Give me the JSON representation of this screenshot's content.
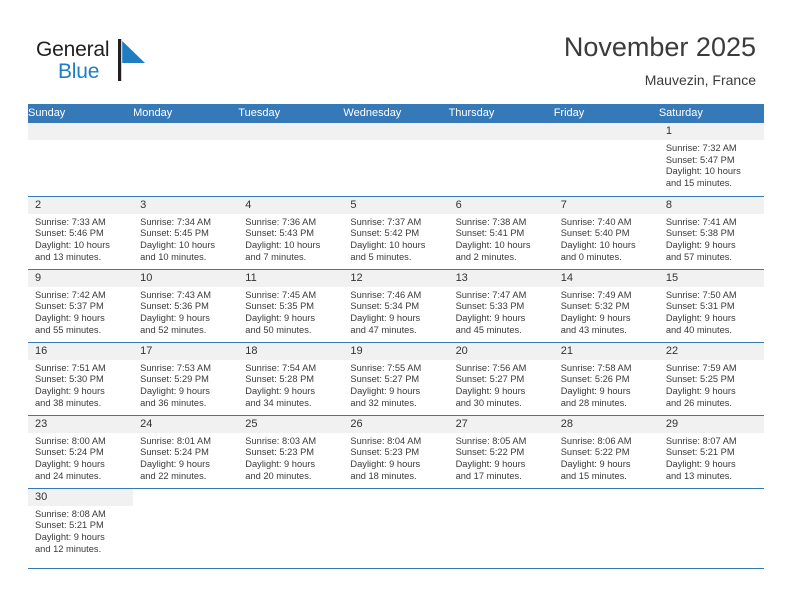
{
  "brand": {
    "name_part1": "General",
    "name_part2": "Blue",
    "flag_icon": "blue-triangle-flag-icon"
  },
  "header": {
    "title": "November 2025",
    "subtitle": "Mauvezin, France"
  },
  "calendar": {
    "weekday_headers": [
      "Sunday",
      "Monday",
      "Tuesday",
      "Wednesday",
      "Thursday",
      "Friday",
      "Saturday"
    ],
    "accent_color": "#3579b8",
    "daynum_band_color": "#f1f1f1",
    "labels": {
      "sunrise": "Sunrise:",
      "sunset": "Sunset:",
      "daylight": "Daylight:"
    },
    "weeks": [
      [
        {
          "blank": true
        },
        {
          "blank": true
        },
        {
          "blank": true
        },
        {
          "blank": true
        },
        {
          "blank": true
        },
        {
          "blank": true
        },
        {
          "day": "1",
          "sunrise": "Sunrise: 7:32 AM",
          "sunset": "Sunset: 5:47 PM",
          "daylight_line1": "Daylight: 10 hours",
          "daylight_line2": "and 15 minutes."
        }
      ],
      [
        {
          "day": "2",
          "sunrise": "Sunrise: 7:33 AM",
          "sunset": "Sunset: 5:46 PM",
          "daylight_line1": "Daylight: 10 hours",
          "daylight_line2": "and 13 minutes."
        },
        {
          "day": "3",
          "sunrise": "Sunrise: 7:34 AM",
          "sunset": "Sunset: 5:45 PM",
          "daylight_line1": "Daylight: 10 hours",
          "daylight_line2": "and 10 minutes."
        },
        {
          "day": "4",
          "sunrise": "Sunrise: 7:36 AM",
          "sunset": "Sunset: 5:43 PM",
          "daylight_line1": "Daylight: 10 hours",
          "daylight_line2": "and 7 minutes."
        },
        {
          "day": "5",
          "sunrise": "Sunrise: 7:37 AM",
          "sunset": "Sunset: 5:42 PM",
          "daylight_line1": "Daylight: 10 hours",
          "daylight_line2": "and 5 minutes."
        },
        {
          "day": "6",
          "sunrise": "Sunrise: 7:38 AM",
          "sunset": "Sunset: 5:41 PM",
          "daylight_line1": "Daylight: 10 hours",
          "daylight_line2": "and 2 minutes."
        },
        {
          "day": "7",
          "sunrise": "Sunrise: 7:40 AM",
          "sunset": "Sunset: 5:40 PM",
          "daylight_line1": "Daylight: 10 hours",
          "daylight_line2": "and 0 minutes."
        },
        {
          "day": "8",
          "sunrise": "Sunrise: 7:41 AM",
          "sunset": "Sunset: 5:38 PM",
          "daylight_line1": "Daylight: 9 hours",
          "daylight_line2": "and 57 minutes."
        }
      ],
      [
        {
          "day": "9",
          "sunrise": "Sunrise: 7:42 AM",
          "sunset": "Sunset: 5:37 PM",
          "daylight_line1": "Daylight: 9 hours",
          "daylight_line2": "and 55 minutes."
        },
        {
          "day": "10",
          "sunrise": "Sunrise: 7:43 AM",
          "sunset": "Sunset: 5:36 PM",
          "daylight_line1": "Daylight: 9 hours",
          "daylight_line2": "and 52 minutes."
        },
        {
          "day": "11",
          "sunrise": "Sunrise: 7:45 AM",
          "sunset": "Sunset: 5:35 PM",
          "daylight_line1": "Daylight: 9 hours",
          "daylight_line2": "and 50 minutes."
        },
        {
          "day": "12",
          "sunrise": "Sunrise: 7:46 AM",
          "sunset": "Sunset: 5:34 PM",
          "daylight_line1": "Daylight: 9 hours",
          "daylight_line2": "and 47 minutes."
        },
        {
          "day": "13",
          "sunrise": "Sunrise: 7:47 AM",
          "sunset": "Sunset: 5:33 PM",
          "daylight_line1": "Daylight: 9 hours",
          "daylight_line2": "and 45 minutes."
        },
        {
          "day": "14",
          "sunrise": "Sunrise: 7:49 AM",
          "sunset": "Sunset: 5:32 PM",
          "daylight_line1": "Daylight: 9 hours",
          "daylight_line2": "and 43 minutes."
        },
        {
          "day": "15",
          "sunrise": "Sunrise: 7:50 AM",
          "sunset": "Sunset: 5:31 PM",
          "daylight_line1": "Daylight: 9 hours",
          "daylight_line2": "and 40 minutes."
        }
      ],
      [
        {
          "day": "16",
          "sunrise": "Sunrise: 7:51 AM",
          "sunset": "Sunset: 5:30 PM",
          "daylight_line1": "Daylight: 9 hours",
          "daylight_line2": "and 38 minutes."
        },
        {
          "day": "17",
          "sunrise": "Sunrise: 7:53 AM",
          "sunset": "Sunset: 5:29 PM",
          "daylight_line1": "Daylight: 9 hours",
          "daylight_line2": "and 36 minutes."
        },
        {
          "day": "18",
          "sunrise": "Sunrise: 7:54 AM",
          "sunset": "Sunset: 5:28 PM",
          "daylight_line1": "Daylight: 9 hours",
          "daylight_line2": "and 34 minutes."
        },
        {
          "day": "19",
          "sunrise": "Sunrise: 7:55 AM",
          "sunset": "Sunset: 5:27 PM",
          "daylight_line1": "Daylight: 9 hours",
          "daylight_line2": "and 32 minutes."
        },
        {
          "day": "20",
          "sunrise": "Sunrise: 7:56 AM",
          "sunset": "Sunset: 5:27 PM",
          "daylight_line1": "Daylight: 9 hours",
          "daylight_line2": "and 30 minutes."
        },
        {
          "day": "21",
          "sunrise": "Sunrise: 7:58 AM",
          "sunset": "Sunset: 5:26 PM",
          "daylight_line1": "Daylight: 9 hours",
          "daylight_line2": "and 28 minutes."
        },
        {
          "day": "22",
          "sunrise": "Sunrise: 7:59 AM",
          "sunset": "Sunset: 5:25 PM",
          "daylight_line1": "Daylight: 9 hours",
          "daylight_line2": "and 26 minutes."
        }
      ],
      [
        {
          "day": "23",
          "sunrise": "Sunrise: 8:00 AM",
          "sunset": "Sunset: 5:24 PM",
          "daylight_line1": "Daylight: 9 hours",
          "daylight_line2": "and 24 minutes."
        },
        {
          "day": "24",
          "sunrise": "Sunrise: 8:01 AM",
          "sunset": "Sunset: 5:24 PM",
          "daylight_line1": "Daylight: 9 hours",
          "daylight_line2": "and 22 minutes."
        },
        {
          "day": "25",
          "sunrise": "Sunrise: 8:03 AM",
          "sunset": "Sunset: 5:23 PM",
          "daylight_line1": "Daylight: 9 hours",
          "daylight_line2": "and 20 minutes."
        },
        {
          "day": "26",
          "sunrise": "Sunrise: 8:04 AM",
          "sunset": "Sunset: 5:23 PM",
          "daylight_line1": "Daylight: 9 hours",
          "daylight_line2": "and 18 minutes."
        },
        {
          "day": "27",
          "sunrise": "Sunrise: 8:05 AM",
          "sunset": "Sunset: 5:22 PM",
          "daylight_line1": "Daylight: 9 hours",
          "daylight_line2": "and 17 minutes."
        },
        {
          "day": "28",
          "sunrise": "Sunrise: 8:06 AM",
          "sunset": "Sunset: 5:22 PM",
          "daylight_line1": "Daylight: 9 hours",
          "daylight_line2": "and 15 minutes."
        },
        {
          "day": "29",
          "sunrise": "Sunrise: 8:07 AM",
          "sunset": "Sunset: 5:21 PM",
          "daylight_line1": "Daylight: 9 hours",
          "daylight_line2": "and 13 minutes."
        }
      ],
      [
        {
          "day": "30",
          "sunrise": "Sunrise: 8:08 AM",
          "sunset": "Sunset: 5:21 PM",
          "daylight_line1": "Daylight: 9 hours",
          "daylight_line2": "and 12 minutes."
        },
        {
          "blank": true
        },
        {
          "blank": true
        },
        {
          "blank": true
        },
        {
          "blank": true
        },
        {
          "blank": true
        },
        {
          "blank": true
        }
      ]
    ]
  }
}
